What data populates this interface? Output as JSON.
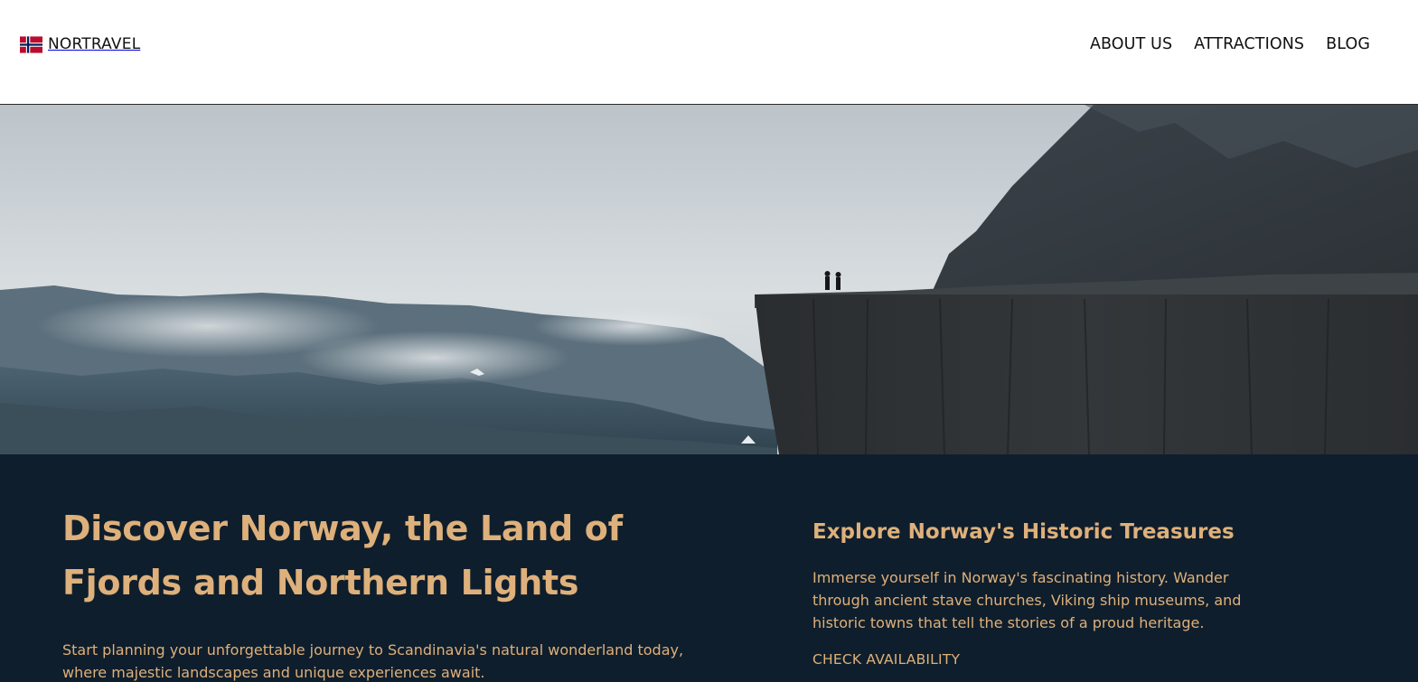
{
  "header": {
    "brand": {
      "flag_icon": "norway-flag-icon",
      "name": "NORTRAVEL"
    },
    "nav": [
      {
        "label": "ABOUT US"
      },
      {
        "label": "ATTRACTIONS"
      },
      {
        "label": "BLOG"
      }
    ]
  },
  "hero": {
    "image": "norway-cliff-fjord-photo"
  },
  "intro": {
    "headline": "Discover Norway, the Land of Fjords and Northern Lights",
    "lead": "Start planning your unforgettable journey to Scandinavia's natural wonderland today, where majestic landscapes and unique experiences await."
  },
  "treasures": {
    "title": "Explore Norway's Historic Treasures",
    "text": "Immerse yourself in Norway's fascinating history. Wander through ancient stave churches, Viking ship museums, and historic towns that tell the stories of a proud heritage.",
    "cta_label": "CHECK AVAILABILITY"
  },
  "colors": {
    "header_bg": "#ffffff",
    "section_bg": "#0f1e2c",
    "accent_gold": "#deb07b",
    "text_dark": "#111111"
  }
}
